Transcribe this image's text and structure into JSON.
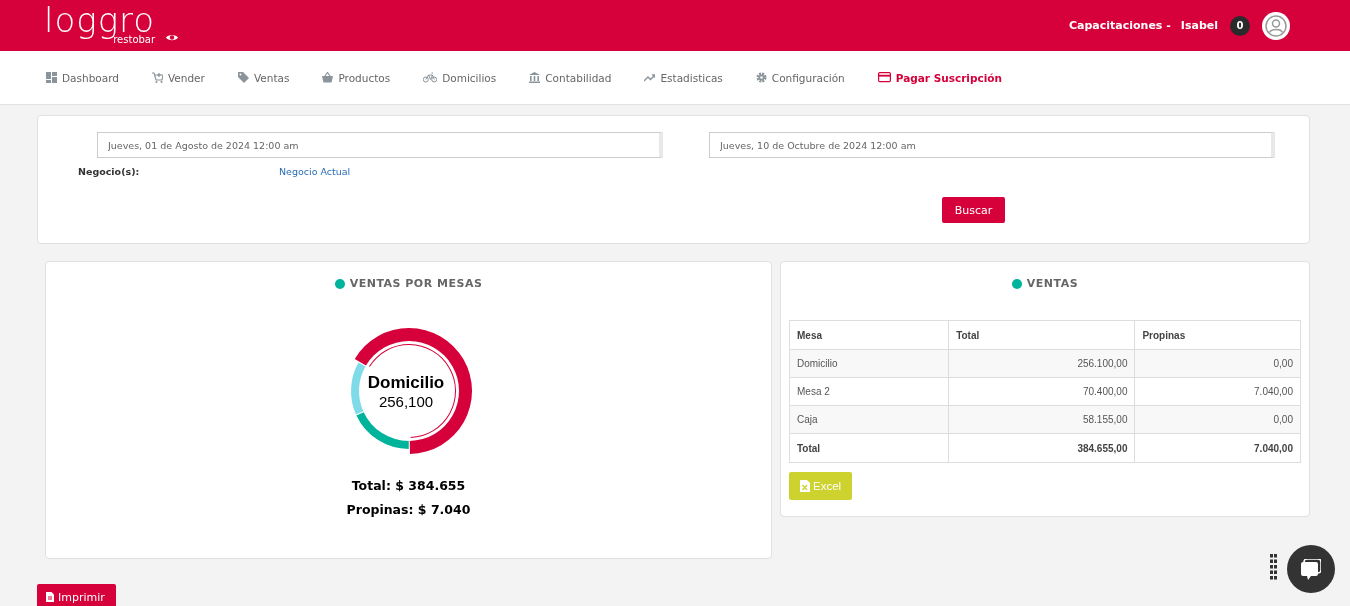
{
  "header": {
    "logo": "loggro",
    "logo_sub": "restobar",
    "company": "Capacitaciones -",
    "user": "Isabel",
    "notifications": "0"
  },
  "nav": [
    {
      "label": "Dashboard",
      "selected": false
    },
    {
      "label": "Vender",
      "selected": false
    },
    {
      "label": "Ventas",
      "selected": false
    },
    {
      "label": "Productos",
      "selected": false
    },
    {
      "label": "Domicilios",
      "selected": false
    },
    {
      "label": "Contabilidad",
      "selected": false
    },
    {
      "label": "Estadisticas",
      "selected": false
    },
    {
      "label": "Configuración",
      "selected": false
    },
    {
      "label": "Pagar Suscripción",
      "selected": true
    }
  ],
  "filters": {
    "date_from": "Jueves, 01 de Agosto de 2024 12:00 am",
    "date_to": "Jueves, 10 de Octubre de 2024 12:00 am",
    "business_label": "Negocio(s):",
    "business_value": "Negocio Actual",
    "search_button": "Buscar"
  },
  "sales_by_table": {
    "title": "VENTAS POR MESAS",
    "center_label": "Domicilio",
    "center_value": "256,100",
    "total": "Total: $ 384.655",
    "tips": "Propinas: $ 7.040"
  },
  "sales": {
    "title": "VENTAS",
    "columns": [
      "Mesa",
      "Total",
      "Propinas"
    ],
    "rows": [
      [
        "Domicilio",
        "256.100,00",
        "0,00"
      ],
      [
        "Mesa 2",
        "70.400,00",
        "7.040,00"
      ],
      [
        "Caja",
        "58.155,00",
        "0,00"
      ]
    ],
    "footer": [
      "Total",
      "384.655,00",
      "7.040,00"
    ],
    "excel_button": "Excel"
  },
  "print_button": "Imprimir"
}
